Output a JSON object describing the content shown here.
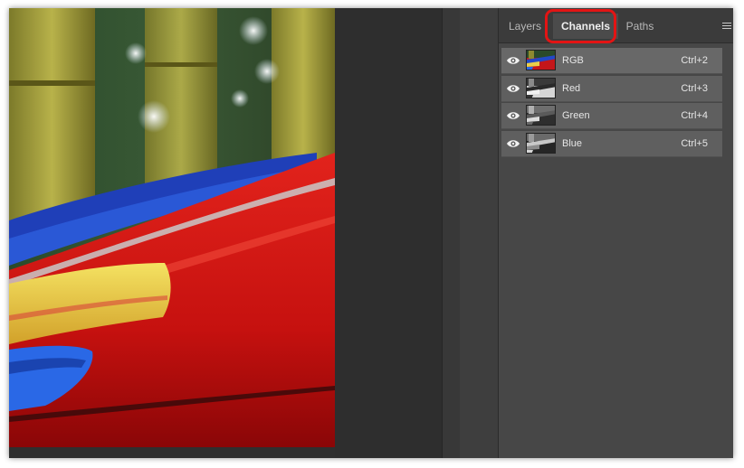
{
  "panel": {
    "tabs": [
      {
        "label": "Layers",
        "active": false
      },
      {
        "label": "Channels",
        "active": true
      },
      {
        "label": "Paths",
        "active": false
      }
    ],
    "menu_icon": "hamburger-menu-icon",
    "highlight_color": "#e31414"
  },
  "channels": [
    {
      "name": "RGB",
      "shortcut": "Ctrl+2",
      "visible": true,
      "thumb": "color"
    },
    {
      "name": "Red",
      "shortcut": "Ctrl+3",
      "visible": true,
      "thumb": "grayscale"
    },
    {
      "name": "Green",
      "shortcut": "Ctrl+4",
      "visible": true,
      "thumb": "grayscale"
    },
    {
      "name": "Blue",
      "shortcut": "Ctrl+5",
      "visible": true,
      "thumb": "grayscale"
    }
  ]
}
